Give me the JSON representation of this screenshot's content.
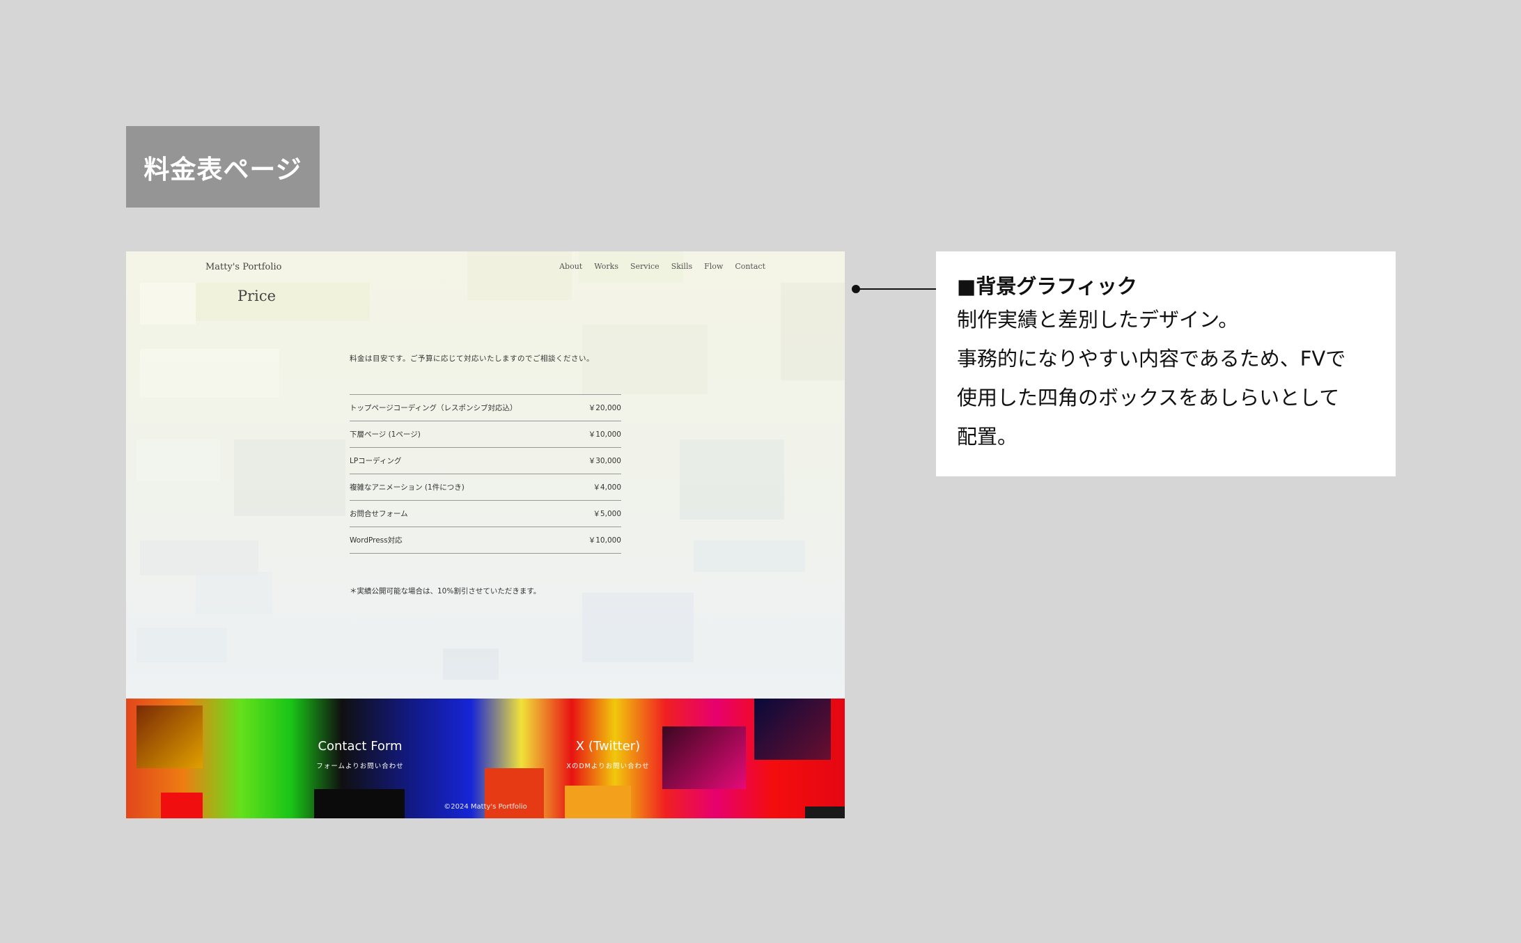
{
  "page_label": "料金表ページ",
  "mock": {
    "brand": "Matty's Portfolio",
    "nav": [
      "About",
      "Works",
      "Service",
      "Skills",
      "Flow",
      "Contact"
    ],
    "title": "Price",
    "intro": "料金は目安です。ご予算に応じて対応いたしますのでご相談ください。",
    "price_rows": [
      {
        "item": "トップページコーディング（レスポンシブ対応込）",
        "price": "￥20,000"
      },
      {
        "item": "下層ページ (1ページ)",
        "price": "￥10,000"
      },
      {
        "item": "LPコーディング",
        "price": "￥30,000"
      },
      {
        "item": "複雑なアニメーション (1件につき)",
        "price": "￥4,000"
      },
      {
        "item": "お問合せフォーム",
        "price": "￥5,000"
      },
      {
        "item": "WordPress対応",
        "price": "￥10,000"
      }
    ],
    "note": "＊実績公開可能な場合は、10%割引させていただきます。",
    "footer": {
      "contact_title": "Contact Form",
      "contact_sub": "フォームよりお問い合わせ",
      "x_title": "X (Twitter)",
      "x_sub": "XのDMよりお問い合わせ",
      "copyright": "©2024 Matty's Portfolio"
    }
  },
  "callout": {
    "heading": "■背景グラフィック",
    "lines": [
      "制作実績と差別したデザイン。",
      "事務的になりやすい内容であるため、FVで",
      "使用した四角のボックスをあしらいとして",
      "配置。"
    ]
  }
}
